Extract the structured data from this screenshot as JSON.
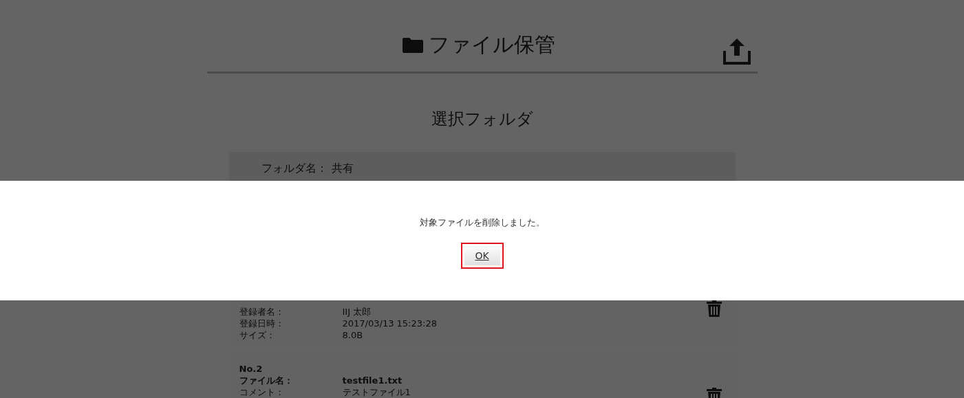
{
  "header": {
    "title": "ファイル保管"
  },
  "section_title": "選択フォルダ",
  "folder": {
    "label": "フォルダ名：",
    "value": "共有"
  },
  "files": [
    {
      "rows": [
        {
          "label": "登録者名：",
          "value": "IIJ 太郎",
          "kind": "plain"
        },
        {
          "label": "登録日時：",
          "value": "2017/03/13 15:23:28",
          "kind": "plain"
        },
        {
          "label": "サイズ：",
          "value": "8.0B",
          "kind": "plain"
        }
      ]
    },
    {
      "number": "No.2",
      "rows": [
        {
          "label": "ファイル名：",
          "value": "testfile1.txt",
          "kind": "bold"
        },
        {
          "label": "コメント：",
          "value": "テストファイル1",
          "kind": "plain"
        }
      ]
    }
  ],
  "dialog": {
    "message": "対象ファイルを削除しました。",
    "button": "OK",
    "focused": true
  }
}
